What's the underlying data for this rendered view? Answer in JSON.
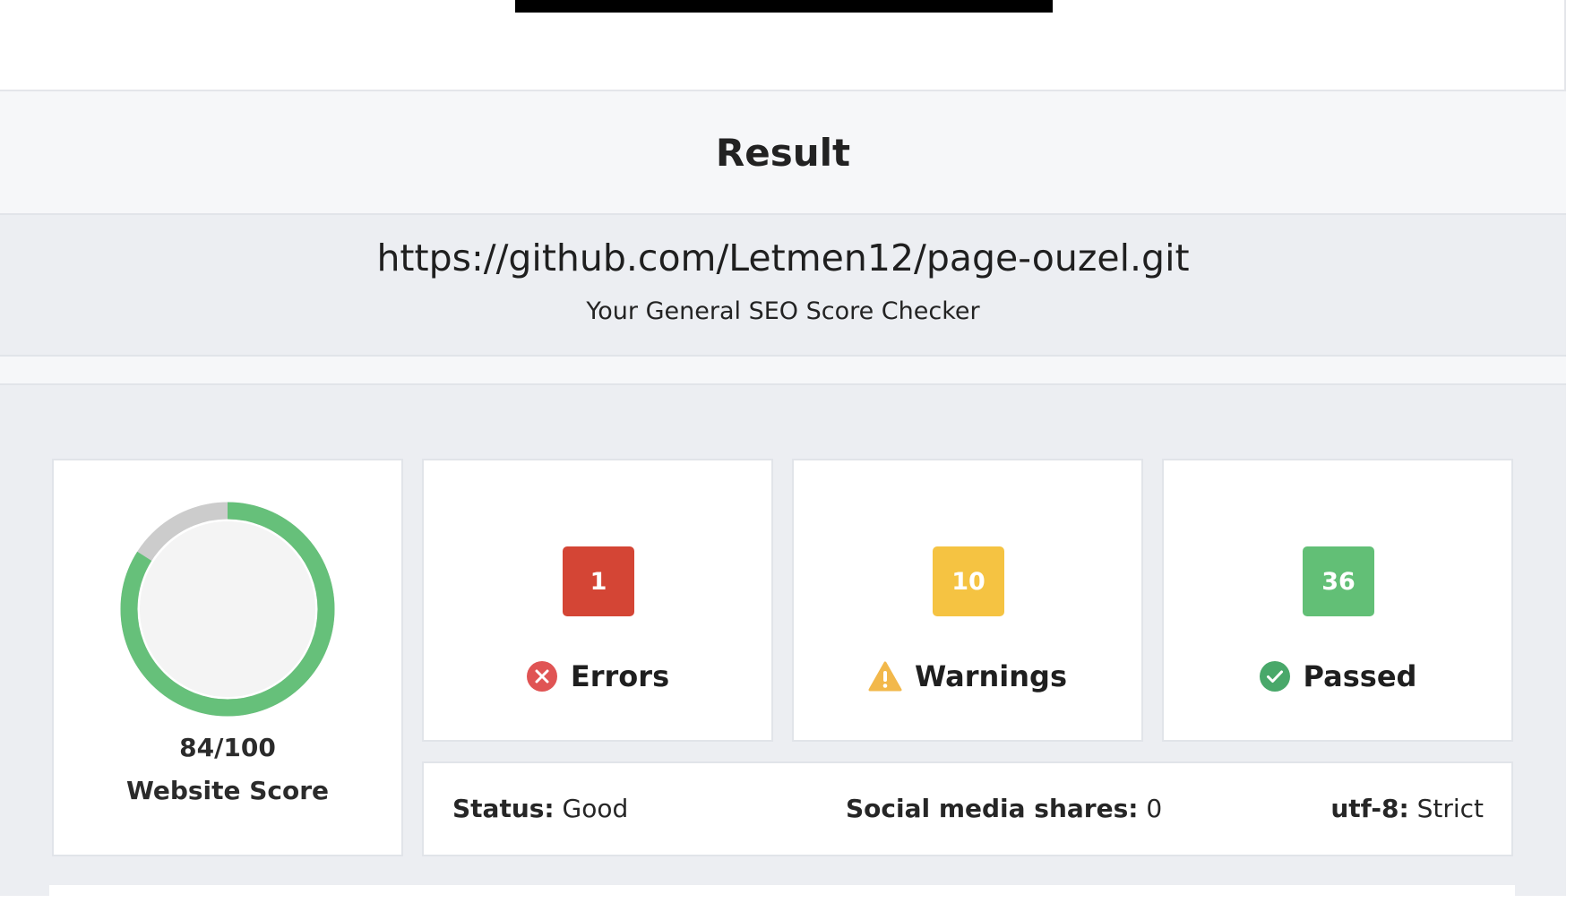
{
  "result": {
    "heading": "Result",
    "url": "https://github.com/Letmen12/page-ouzel.git",
    "subtitle": "Your General SEO Score Checker"
  },
  "score": {
    "text": "84/100",
    "percent": 84,
    "label": "Website Score",
    "ring_color": "#66c07a",
    "track_color": "#cccccc"
  },
  "counts": {
    "errors": {
      "value": "1",
      "label": "Errors",
      "color": "#d44535",
      "icon": "error-x-circle-icon"
    },
    "warnings": {
      "value": "10",
      "label": "Warnings",
      "color": "#f5c342",
      "icon": "warning-triangle-icon"
    },
    "passed": {
      "value": "36",
      "label": "Passed",
      "color": "#62bf76",
      "icon": "check-circle-icon"
    }
  },
  "info": {
    "status_label": "Status:",
    "status_value": "Good",
    "social_label": "Social media shares:",
    "social_value": "0",
    "encoding_label": "utf-8:",
    "encoding_value": "Strict"
  }
}
